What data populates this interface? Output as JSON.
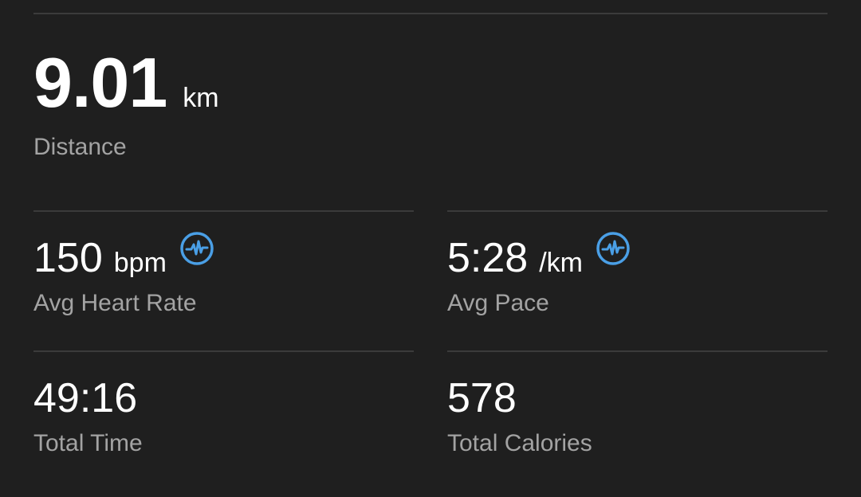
{
  "summary": {
    "distance": {
      "value": "9.01",
      "unit": "km",
      "label": "Distance"
    },
    "avg_heart_rate": {
      "value": "150",
      "unit": "bpm",
      "label": "Avg Heart Rate",
      "icon": "heart-rate-icon"
    },
    "avg_pace": {
      "value": "5:28",
      "unit": "/km",
      "label": "Avg Pace",
      "icon": "heart-rate-icon"
    },
    "total_time": {
      "value": "49:16",
      "label": "Total Time"
    },
    "total_calories": {
      "value": "578",
      "label": "Total Calories"
    }
  },
  "colors": {
    "background": "#1f1f1f",
    "divider": "#3b3b3b",
    "label": "#a3a3a3",
    "value": "#ffffff",
    "icon_accent": "#4a9fe6"
  }
}
